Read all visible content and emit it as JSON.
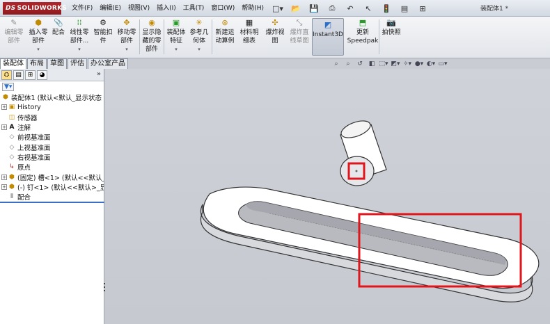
{
  "app": {
    "logo_prefix": "DS",
    "logo_text": "SOLIDWORKS",
    "doc_title": "装配体1 *"
  },
  "menu": [
    "文件(F)",
    "编辑(E)",
    "视图(V)",
    "插入(I)",
    "工具(T)",
    "窗口(W)",
    "帮助(H)"
  ],
  "ribbon": {
    "edit_part": "编辑零部件",
    "insert_part": "插入零部件",
    "mate": "配合",
    "linear_pattern": "线性零部件...",
    "smart_fastener": "智能扣件",
    "move_part": "移动零部件",
    "show_hidden": "显示隐藏的零部件",
    "assembly_feature": "装配体特征",
    "ref_geometry": "参考几何体",
    "new_motion": "新建运动算例",
    "bom": "材料明细表",
    "explode_view": "爆炸视图",
    "explode_line": "爆炸直线草图",
    "instant3d": "Instant3D",
    "update_speedpak": "更新Speedpak",
    "snapshot": "拍快照"
  },
  "tabs": [
    "装配体",
    "布局",
    "草图",
    "评估",
    "办公室产品"
  ],
  "tree": {
    "root": "装配体1 (默认<默认_显示状态",
    "items": [
      "History",
      "传感器",
      "注解",
      "前视基准面",
      "上视基准面",
      "右视基准面",
      "原点",
      "(固定) 槽<1> (默认<<默认_",
      "(-) 钉<1> (默认<<默认>_显",
      "配合"
    ]
  },
  "colors": {
    "highlight_box": "#e0161c",
    "tree_divider": "#3a6fc4",
    "viewport_bg": "#cacdd3"
  }
}
